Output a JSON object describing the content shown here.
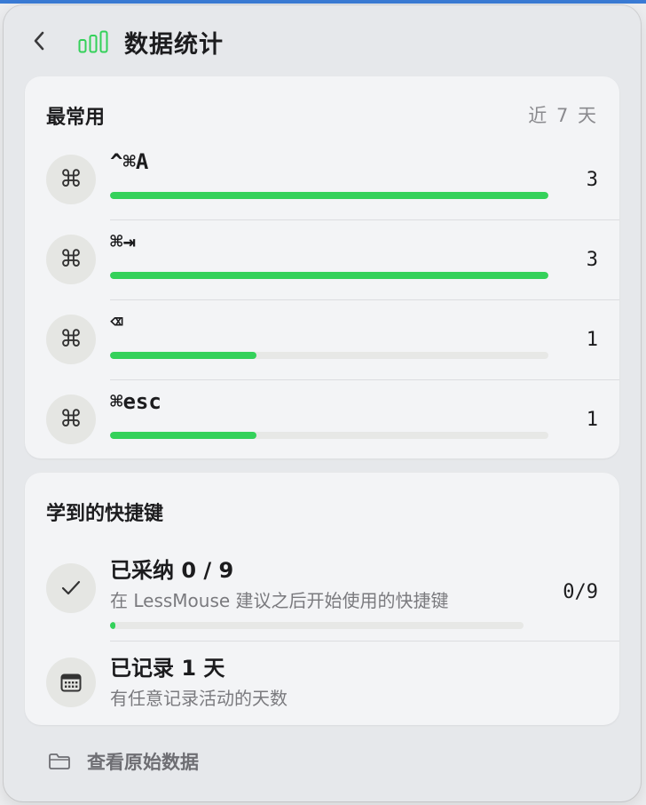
{
  "header": {
    "title": "数据统计",
    "back_icon": "chevron-left-icon",
    "app_icon": "bar-chart-icon",
    "accent": "#34d15a"
  },
  "most_used": {
    "title": "最常用",
    "period": "近 7 天",
    "max_count": 3,
    "items": [
      {
        "icon": "command-icon",
        "shortcut": "^⌘A",
        "count": "3",
        "fraction": 1.0
      },
      {
        "icon": "command-icon",
        "shortcut": "⌘⇥",
        "count": "3",
        "fraction": 1.0
      },
      {
        "icon": "command-icon",
        "shortcut": "⌫",
        "count": "1",
        "fraction": 0.333
      },
      {
        "icon": "command-icon",
        "shortcut": "⌘esc",
        "count": "1",
        "fraction": 0.333
      }
    ]
  },
  "learned": {
    "title": "学到的快捷键",
    "adopted": {
      "icon": "checkmark-icon",
      "title": "已采纳 0 / 9",
      "subtitle": "在 LessMouse 建议之后开始使用的快捷键",
      "count": "0/9",
      "fraction": 0.0
    },
    "recorded": {
      "icon": "calendar-icon",
      "title": "已记录 1 天",
      "subtitle": "有任意记录活动的天数"
    }
  },
  "footer": {
    "icon": "folder-icon",
    "label": "查看原始数据"
  }
}
